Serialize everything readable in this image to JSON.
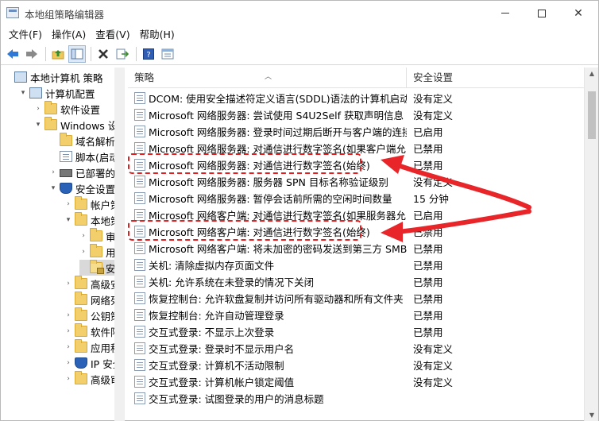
{
  "window": {
    "title": "本地组策略编辑器",
    "minimize_label": "—",
    "maximize_label": "",
    "close_label": "✕"
  },
  "menu": [
    "文件(F)",
    "操作(A)",
    "查看(V)",
    "帮助(H)"
  ],
  "toolbar": {
    "icons": [
      "back-arrow-icon",
      "forward-arrow-icon",
      "up-folder-icon",
      "show-hide-tree-icon",
      "delete-icon",
      "export-list-icon",
      "help-icon",
      "properties-icon"
    ]
  },
  "tree": [
    {
      "label": "本地计算机 策略",
      "icon": "computer-icon",
      "level": 0,
      "expand": ""
    },
    {
      "label": "计算机配置",
      "icon": "computer-icon",
      "level": 1,
      "expand": "▾"
    },
    {
      "label": "软件设置",
      "icon": "folder-icon",
      "level": 2,
      "expand": "›"
    },
    {
      "label": "Windows 设置",
      "icon": "folder-icon",
      "level": 2,
      "expand": "▾"
    },
    {
      "label": "域名解析策",
      "icon": "folder-icon",
      "level": 3,
      "expand": ""
    },
    {
      "label": "脚本(启动)",
      "icon": "script-icon",
      "level": 3,
      "expand": ""
    },
    {
      "label": "已部署的打",
      "icon": "printer-icon",
      "level": 3,
      "expand": "›"
    },
    {
      "label": "安全设置",
      "icon": "security-icon",
      "level": 3,
      "expand": "▾"
    },
    {
      "label": "帐户策",
      "icon": "folder-icon",
      "level": 4,
      "expand": "›"
    },
    {
      "label": "本地策",
      "icon": "folder-icon",
      "level": 4,
      "expand": "▾"
    },
    {
      "label": "审",
      "icon": "folder-icon",
      "level": 5,
      "expand": "›"
    },
    {
      "label": "用",
      "icon": "folder-icon",
      "level": 5,
      "expand": "›"
    },
    {
      "label": "安",
      "icon": "folder-open-icon",
      "level": 5,
      "expand": "",
      "selected": true
    },
    {
      "label": "高级安",
      "icon": "folder-icon",
      "level": 4,
      "expand": "›"
    },
    {
      "label": "网络列",
      "icon": "folder-icon",
      "level": 4,
      "expand": ""
    },
    {
      "label": "公钥策",
      "icon": "folder-icon",
      "level": 4,
      "expand": "›"
    },
    {
      "label": "软件限",
      "icon": "folder-icon",
      "level": 4,
      "expand": "›"
    },
    {
      "label": "应用程",
      "icon": "folder-icon",
      "level": 4,
      "expand": "›"
    },
    {
      "label": "IP 安全",
      "icon": "ip-security-icon",
      "level": 4,
      "expand": "›"
    },
    {
      "label": "高级审",
      "icon": "folder-icon",
      "level": 4,
      "expand": "›"
    }
  ],
  "list": {
    "columns": [
      "策略",
      "安全设置"
    ],
    "rows": [
      {
        "policy": "DCOM: 使用安全描述符定义语言(SDDL)语法的计算机启动...",
        "setting": "没有定义"
      },
      {
        "policy": "Microsoft 网络服务器: 尝试使用 S4U2Self 获取声明信息",
        "setting": "没有定义"
      },
      {
        "policy": "Microsoft 网络服务器: 登录时间过期后断开与客户端的连接",
        "setting": "已启用"
      },
      {
        "policy": "Microsoft 网络服务器: 对通信进行数字签名(如果客户端允...",
        "setting": "已禁用"
      },
      {
        "policy": "Microsoft 网络服务器: 对通信进行数字签名(始终)",
        "setting": "已禁用"
      },
      {
        "policy": "Microsoft 网络服务器: 服务器 SPN 目标名称验证级别",
        "setting": "没有定义"
      },
      {
        "policy": "Microsoft 网络服务器: 暂停会话前所需的空闲时间数量",
        "setting": "15 分钟"
      },
      {
        "policy": "Microsoft 网络客户端: 对通信进行数字签名(如果服务器允...",
        "setting": "已启用"
      },
      {
        "policy": "Microsoft 网络客户端: 对通信进行数字签名(始终)",
        "setting": "已禁用"
      },
      {
        "policy": "Microsoft 网络客户端: 将未加密的密码发送到第三方 SMB...",
        "setting": "已禁用"
      },
      {
        "policy": "关机: 清除虚拟内存页面文件",
        "setting": "已禁用"
      },
      {
        "policy": "关机: 允许系统在未登录的情况下关闭",
        "setting": "已禁用"
      },
      {
        "policy": "恢复控制台: 允许软盘复制并访问所有驱动器和所有文件夹",
        "setting": "已禁用"
      },
      {
        "policy": "恢复控制台: 允许自动管理登录",
        "setting": "已禁用"
      },
      {
        "policy": "交互式登录: 不显示上次登录",
        "setting": "已禁用"
      },
      {
        "policy": "交互式登录: 登录时不显示用户名",
        "setting": "没有定义"
      },
      {
        "policy": "交互式登录: 计算机不活动限制",
        "setting": "没有定义"
      },
      {
        "policy": "交互式登录: 计算机帐户锁定阈值",
        "setting": "没有定义"
      },
      {
        "policy": "交互式登录: 试图登录的用户的消息标题",
        "setting": ""
      }
    ]
  },
  "annotations": {
    "highlight_color": "#e02020",
    "highlighted_rows": [
      4,
      8
    ]
  }
}
